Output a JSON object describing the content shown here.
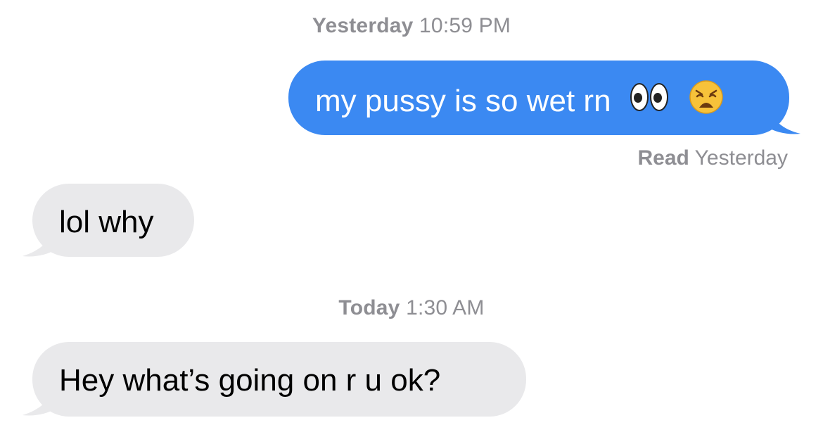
{
  "thread": {
    "timestamps": [
      {
        "day": "Yesterday",
        "time": "10:59 PM"
      },
      {
        "day": "Today",
        "time": "1:30 AM"
      }
    ],
    "messages": [
      {
        "direction": "outgoing",
        "text": "my pussy is so wet rn",
        "emojis": [
          "eyes-emoji",
          "weary-face-emoji"
        ]
      },
      {
        "direction": "incoming",
        "text": "lol why"
      },
      {
        "direction": "incoming",
        "text": "Hey what’s going on r u ok?"
      }
    ],
    "receipt": {
      "status": "Read",
      "when": "Yesterday"
    }
  },
  "colors": {
    "outgoing_bubble": "#3b89f2",
    "incoming_bubble": "#e9e9eb",
    "meta_text": "#8e8e93"
  }
}
